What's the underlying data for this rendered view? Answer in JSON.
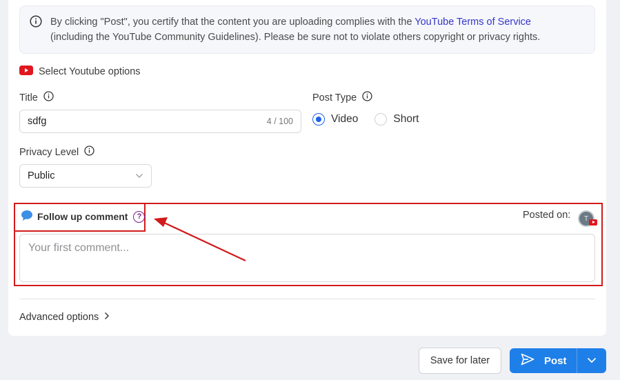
{
  "notice": {
    "text_before": "By clicking \"Post\", you certify that the content you are uploading complies with the ",
    "link_text": "YouTube Terms of Service",
    "text_after": "(including the YouTube Community Guidelines). Please be sure not to violate others copyright or privacy rights."
  },
  "youtube_options": {
    "label": "Select Youtube options"
  },
  "title_field": {
    "label": "Title",
    "value": "sdfg",
    "counter": "4 / 100"
  },
  "post_type": {
    "label": "Post Type",
    "options": [
      {
        "label": "Video",
        "checked": true
      },
      {
        "label": "Short",
        "checked": false
      }
    ]
  },
  "privacy": {
    "label": "Privacy Level",
    "value": "Public"
  },
  "follow_up": {
    "label": "Follow up comment",
    "help": "?",
    "placeholder": "Your first comment..."
  },
  "posted_on": {
    "label": "Posted on:",
    "avatar_initial": "T"
  },
  "advanced": {
    "label": "Advanced options"
  },
  "actions": {
    "save_label": "Save for later",
    "post_label": "Post"
  },
  "colors": {
    "accent": "#1f7fe8",
    "highlight": "#d11a1a",
    "youtube_red": "#e0171f",
    "link": "#3535c7"
  }
}
